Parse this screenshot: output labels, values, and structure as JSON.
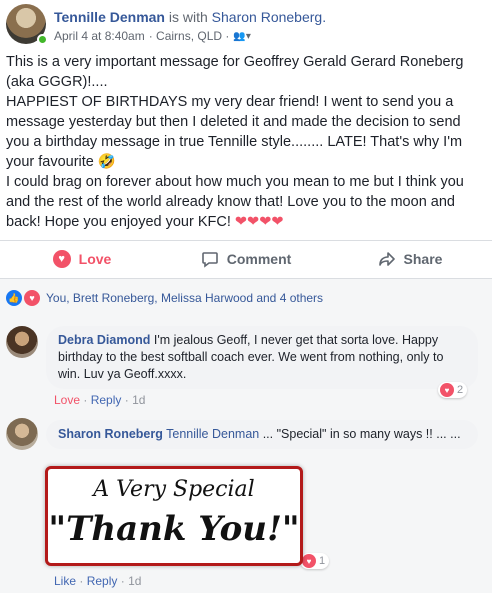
{
  "post": {
    "author": "Tennille Denman",
    "with_text": " is with ",
    "tagged": "Sharon Roneberg.",
    "date": "April 4 at 8:40am",
    "location": "· Cairns, QLD ·",
    "body": "This is a very important message for Geoffrey Gerald Gerard Roneberg (aka GGGR)!....\nHAPPIEST OF BIRTHDAYS my very dear friend! I went to send you a message yesterday but then I deleted it and made the decision to send you a birthday message in true Tennille style........ LATE! That's why I'm your favourite 🤣\nI could brag on forever about how much you mean to me but I think you and the rest of the world already know that! Love you to the moon and back! Hope you enjoyed your KFC! ",
    "hearts": "❤❤❤❤"
  },
  "actions": {
    "love": "Love",
    "comment": "Comment",
    "share": "Share"
  },
  "reactions": {
    "summary": "You, Brett Roneberg, Melissa Harwood and 4 others"
  },
  "comments": [
    {
      "name": "Debra Diamond",
      "text": " I'm jealous Geoff, I never get that sorta love. Happy birthday to the best softball coach ever. We went from nothing, only to win. Luv ya Geoff.xxxx.",
      "action1": "Love",
      "action2": "Reply",
      "time": "1d",
      "count": "2"
    },
    {
      "name": "Sharon Roneberg",
      "tag": "Tennille Denman",
      "text": " ... \"Special\" in so many ways !! ... ...",
      "action1": "Like",
      "action2": "Reply",
      "time": "1d",
      "count": "1",
      "image_line1": "A Very Special",
      "image_line2": "\"Thank You!\""
    }
  ],
  "icons": {
    "like": "like-icon",
    "love": "love-icon",
    "comment": "comment-icon",
    "share": "share-icon",
    "friends": "friends-icon"
  },
  "colors": {
    "link": "#365899",
    "love": "#f25268",
    "meta": "#616770"
  }
}
